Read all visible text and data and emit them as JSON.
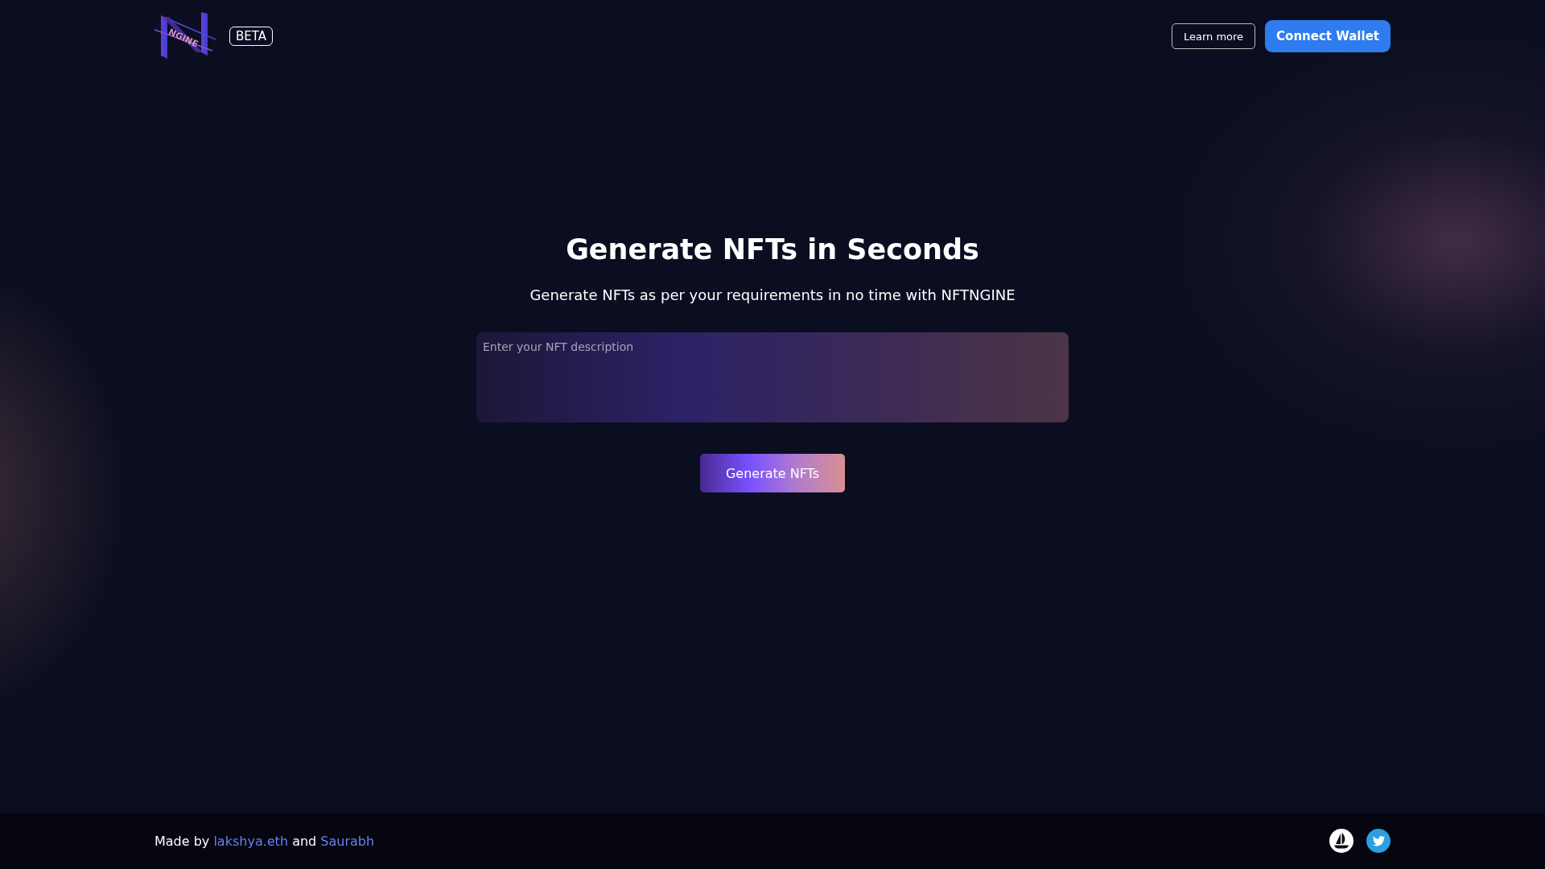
{
  "header": {
    "logo_text": "NGINE",
    "badge": "BETA",
    "buttons": [
      {
        "label": "Learn more",
        "kind": "outline"
      },
      {
        "label": "Connect Wallet",
        "kind": "primary"
      }
    ]
  },
  "hero": {
    "title": "Generate NFTs in Seconds",
    "subtitle": "Generate NFTs as per your requirements in no time with NFTNGINE",
    "description_field": {
      "placeholder": "Enter your NFT description"
    },
    "button": "Generate NFTs"
  },
  "footer": {
    "credit": [
      {
        "kind": "text",
        "text": "Made by"
      },
      {
        "kind": "link",
        "text": "lakshya.eth"
      },
      {
        "kind": "text",
        "text": "and"
      },
      {
        "kind": "link",
        "text": "Saurabh"
      }
    ],
    "social": [
      {
        "kind": "ship"
      },
      {
        "kind": "bird"
      }
    ]
  }
}
